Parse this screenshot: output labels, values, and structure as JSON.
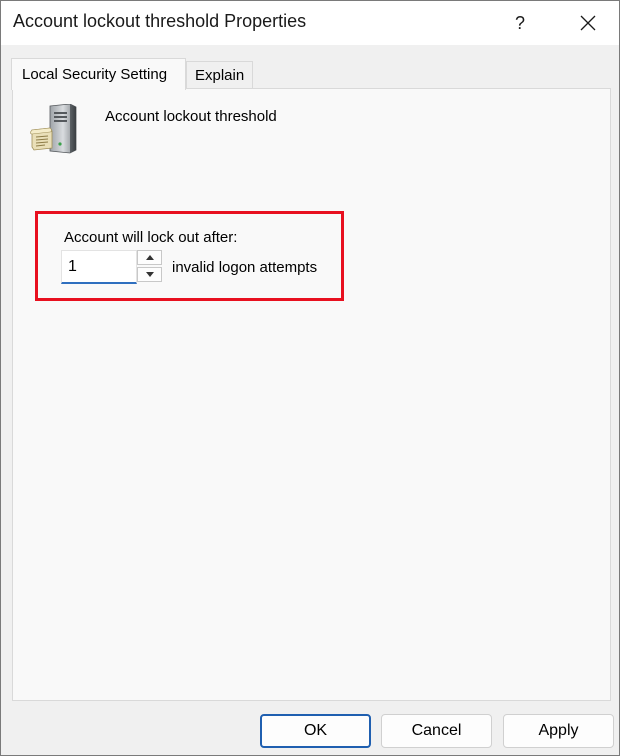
{
  "window": {
    "title": "Account lockout threshold Properties",
    "help_glyph": "?",
    "close_icon": "close-icon"
  },
  "tabs": [
    {
      "label": "Local Security Setting",
      "active": true
    },
    {
      "label": "Explain",
      "active": false
    }
  ],
  "policy": {
    "icon": "server-policy-icon",
    "name": "Account lockout threshold"
  },
  "setting": {
    "label": "Account will lock out after:",
    "value": "1",
    "suffix": "invalid logon attempts",
    "highlight_color": "#e8101f"
  },
  "buttons": {
    "ok": "OK",
    "cancel": "Cancel",
    "apply": "Apply"
  },
  "colors": {
    "accent": "#1f5fb0",
    "panel_bg": "#f9f9f9",
    "window_bg": "#f0f0f0"
  }
}
